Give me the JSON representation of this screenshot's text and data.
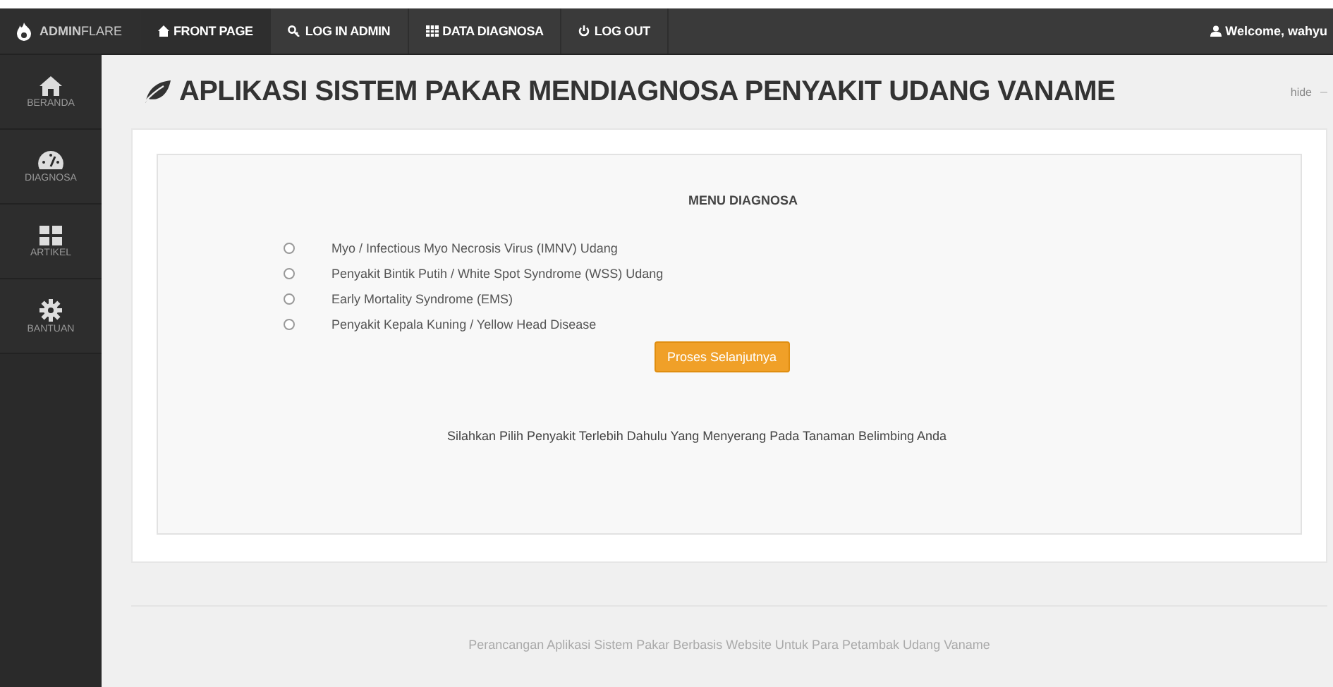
{
  "navbar": {
    "brand": "**ADMIN**FLARE",
    "items": [
      {
        "label": "FRONT PAGE",
        "selected": true
      },
      {
        "label": "LOG IN ADMIN",
        "selected": false
      },
      {
        "label": "DATA DIAGNOSA",
        "selected": false
      },
      {
        "label": "LOG OUT",
        "selected": false
      }
    ],
    "user": "Welcome, wahyu"
  },
  "sidebar": {
    "items": [
      {
        "label": "BERANDA"
      },
      {
        "label": "DIAGNOSA"
      },
      {
        "label": "ARTIKEL"
      },
      {
        "label": "BANTUAN"
      }
    ]
  },
  "page": {
    "title": "APLIKASI SISTEM PAKAR MENDIAGNOSA PENYAKIT UDANG VANAME",
    "hide_link": "hide",
    "heading": "MENU DIAGNOSA",
    "options": [
      {
        "label": "Myo / Infectious Myo Necrosis Virus (IMNV) Udang",
        "selected": false
      },
      {
        "label": "Penyakit Bintik Putih / White Spot Syndrome (WSS) Udang",
        "selected": false
      },
      {
        "label": "Early Mortality Syndrome (EMS)",
        "selected": false
      },
      {
        "label": "Penyakit Kepala Kuning / Yellow Head Disease",
        "selected": false
      }
    ],
    "button": "Proses Selanjutnya",
    "note": "Silahkan Pilih Penyakit Terlebih Dahulu Yang Menyerang Pada Tanaman Belimbing Anda"
  },
  "footer": "Perancangan Aplikasi Sistem Pakar Berbasis Website Untuk Para Petambak Udang Vaname"
}
